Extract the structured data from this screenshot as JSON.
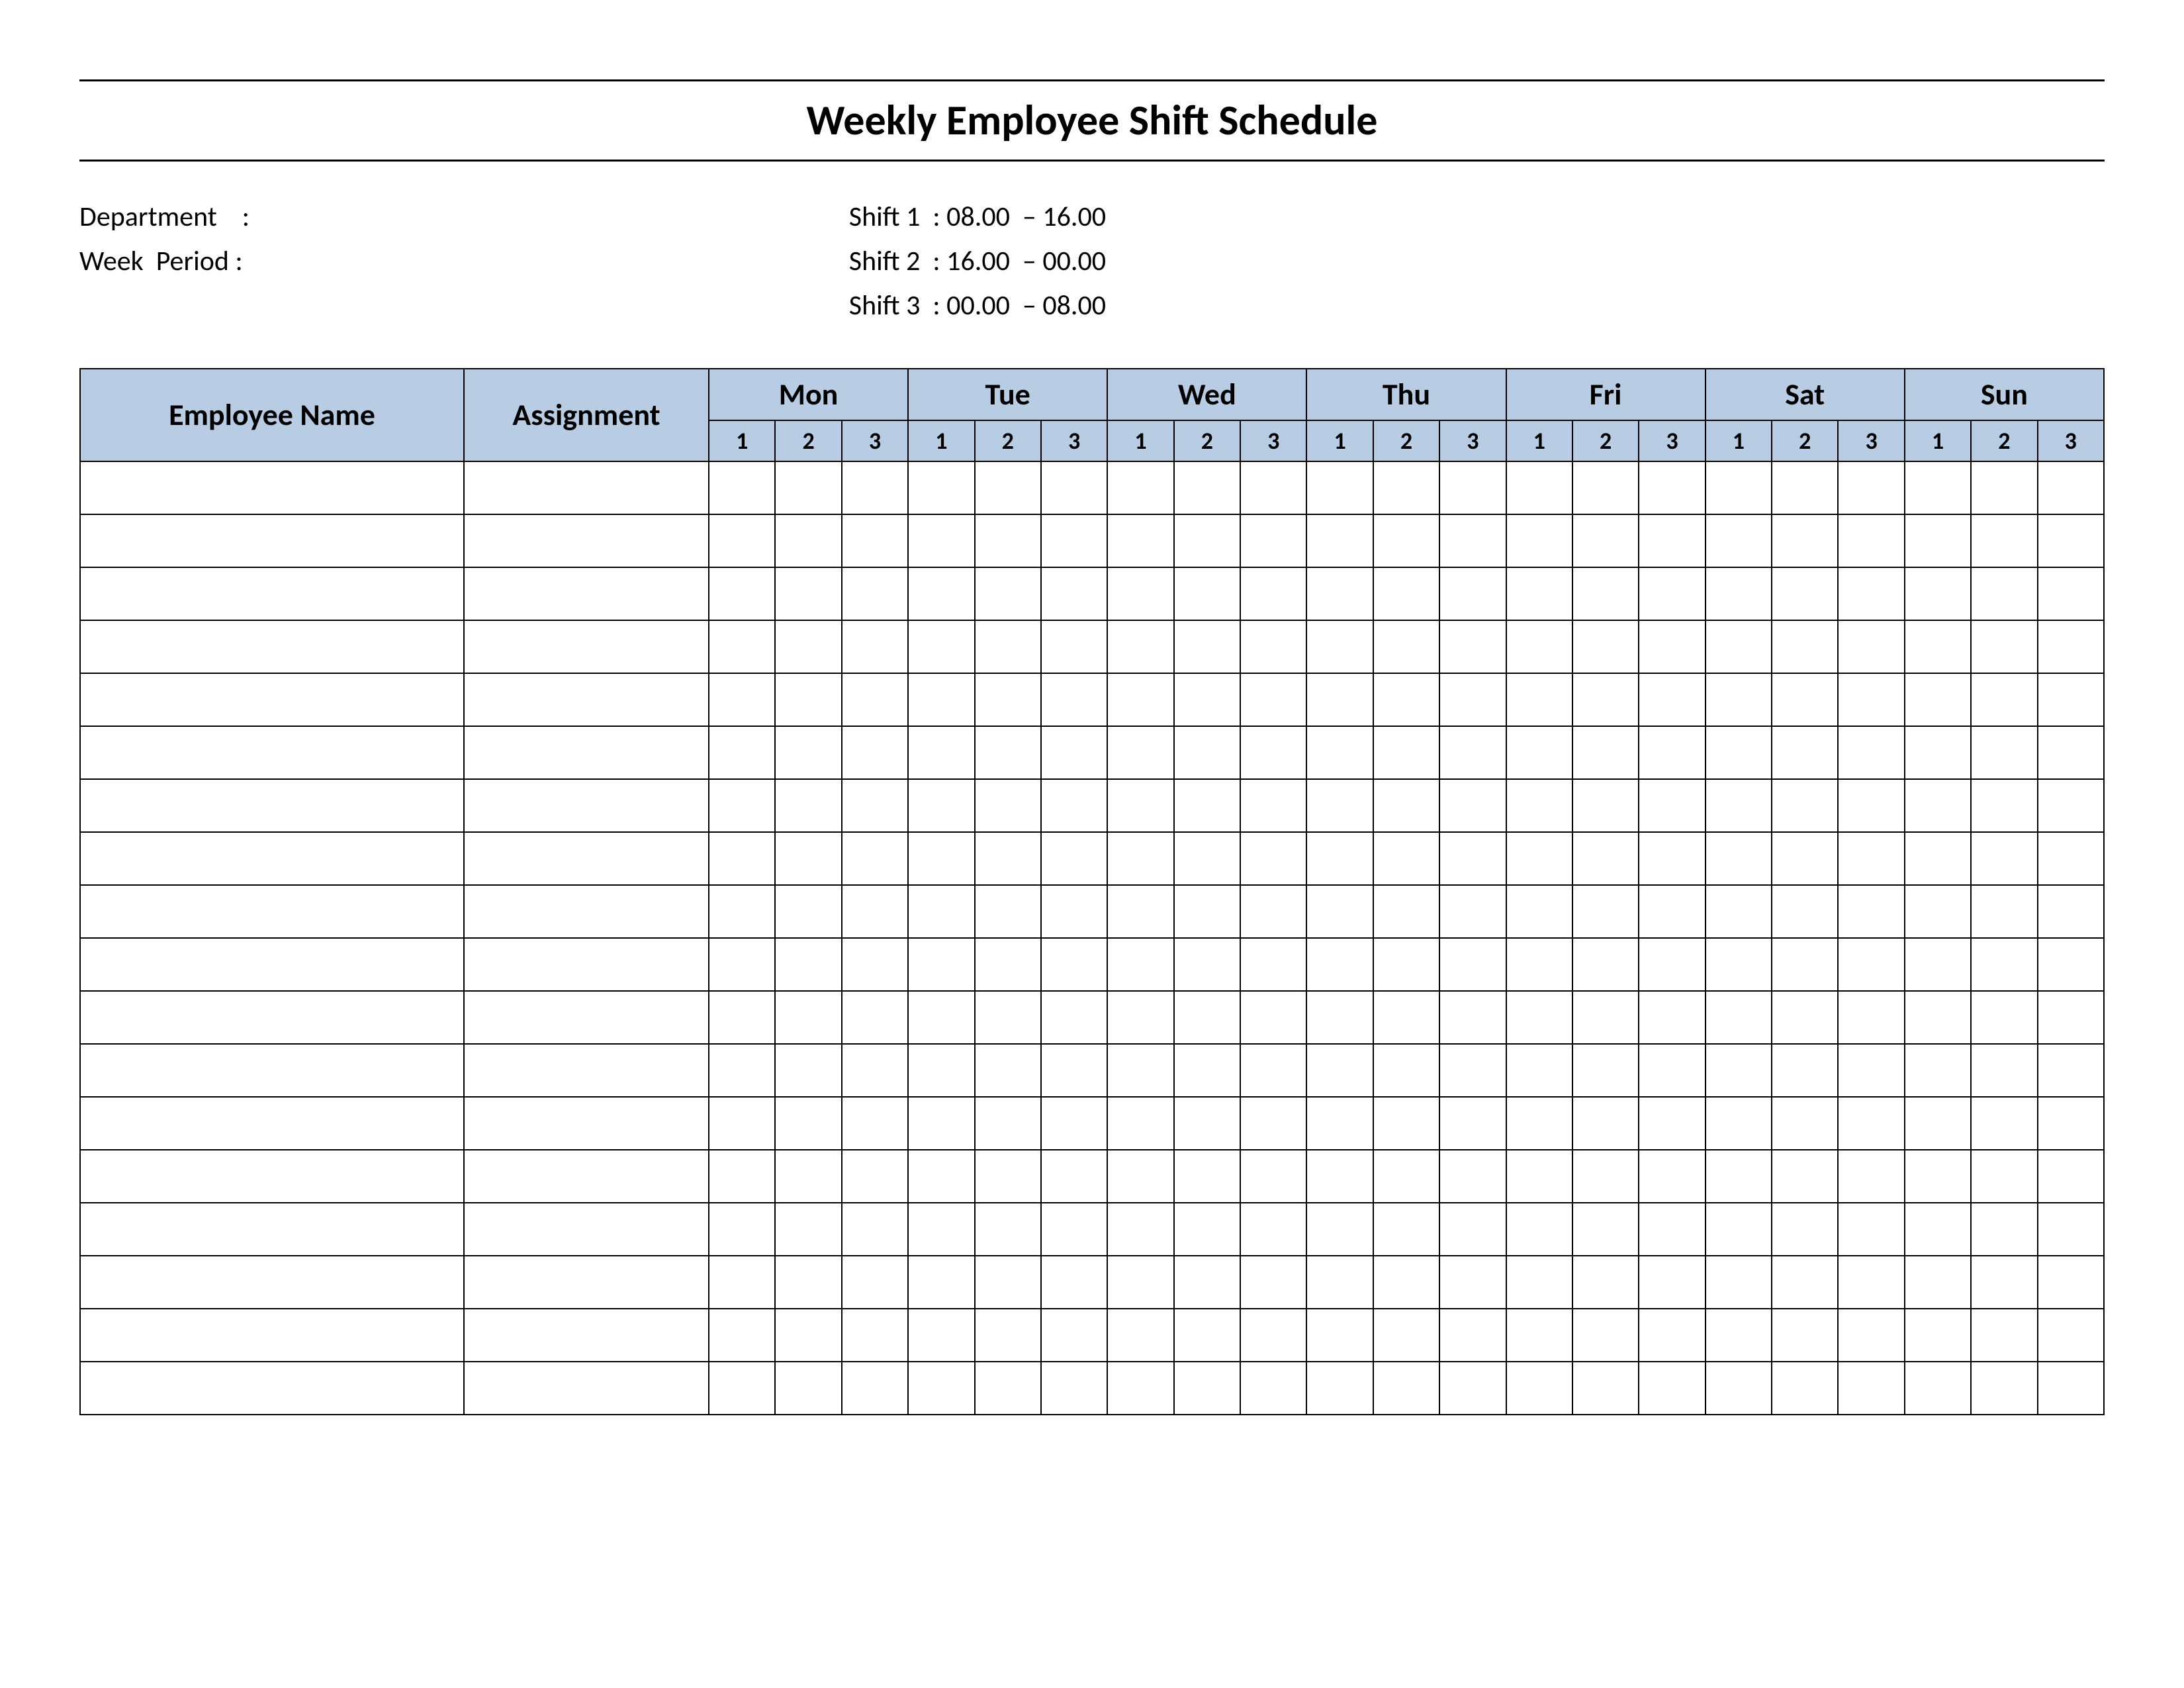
{
  "title": "Weekly Employee Shift Schedule",
  "meta": {
    "department_label": "Department    :",
    "week_period_label": "Week  Period :",
    "shift1": "Shift 1  : 08.00  – 16.00",
    "shift2": "Shift 2  : 16.00  – 00.00",
    "shift3": "Shift 3  : 00.00  – 08.00"
  },
  "headers": {
    "employee_name": "Employee Name",
    "assignment": "Assignment",
    "days": [
      "Mon",
      "Tue",
      "Wed",
      "Thu",
      "Fri",
      "Sat",
      "Sun"
    ],
    "shifts": [
      "1",
      "2",
      "3"
    ]
  },
  "rows": [
    {
      "name": "",
      "assignment": "",
      "cells": [
        "",
        "",
        "",
        "",
        "",
        "",
        "",
        "",
        "",
        "",
        "",
        "",
        "",
        "",
        "",
        "",
        "",
        "",
        "",
        "",
        ""
      ]
    },
    {
      "name": "",
      "assignment": "",
      "cells": [
        "",
        "",
        "",
        "",
        "",
        "",
        "",
        "",
        "",
        "",
        "",
        "",
        "",
        "",
        "",
        "",
        "",
        "",
        "",
        "",
        ""
      ]
    },
    {
      "name": "",
      "assignment": "",
      "cells": [
        "",
        "",
        "",
        "",
        "",
        "",
        "",
        "",
        "",
        "",
        "",
        "",
        "",
        "",
        "",
        "",
        "",
        "",
        "",
        "",
        ""
      ]
    },
    {
      "name": "",
      "assignment": "",
      "cells": [
        "",
        "",
        "",
        "",
        "",
        "",
        "",
        "",
        "",
        "",
        "",
        "",
        "",
        "",
        "",
        "",
        "",
        "",
        "",
        "",
        ""
      ]
    },
    {
      "name": "",
      "assignment": "",
      "cells": [
        "",
        "",
        "",
        "",
        "",
        "",
        "",
        "",
        "",
        "",
        "",
        "",
        "",
        "",
        "",
        "",
        "",
        "",
        "",
        "",
        ""
      ]
    },
    {
      "name": "",
      "assignment": "",
      "cells": [
        "",
        "",
        "",
        "",
        "",
        "",
        "",
        "",
        "",
        "",
        "",
        "",
        "",
        "",
        "",
        "",
        "",
        "",
        "",
        "",
        ""
      ]
    },
    {
      "name": "",
      "assignment": "",
      "cells": [
        "",
        "",
        "",
        "",
        "",
        "",
        "",
        "",
        "",
        "",
        "",
        "",
        "",
        "",
        "",
        "",
        "",
        "",
        "",
        "",
        ""
      ]
    },
    {
      "name": "",
      "assignment": "",
      "cells": [
        "",
        "",
        "",
        "",
        "",
        "",
        "",
        "",
        "",
        "",
        "",
        "",
        "",
        "",
        "",
        "",
        "",
        "",
        "",
        "",
        ""
      ]
    },
    {
      "name": "",
      "assignment": "",
      "cells": [
        "",
        "",
        "",
        "",
        "",
        "",
        "",
        "",
        "",
        "",
        "",
        "",
        "",
        "",
        "",
        "",
        "",
        "",
        "",
        "",
        ""
      ]
    },
    {
      "name": "",
      "assignment": "",
      "cells": [
        "",
        "",
        "",
        "",
        "",
        "",
        "",
        "",
        "",
        "",
        "",
        "",
        "",
        "",
        "",
        "",
        "",
        "",
        "",
        "",
        ""
      ]
    },
    {
      "name": "",
      "assignment": "",
      "cells": [
        "",
        "",
        "",
        "",
        "",
        "",
        "",
        "",
        "",
        "",
        "",
        "",
        "",
        "",
        "",
        "",
        "",
        "",
        "",
        "",
        ""
      ]
    },
    {
      "name": "",
      "assignment": "",
      "cells": [
        "",
        "",
        "",
        "",
        "",
        "",
        "",
        "",
        "",
        "",
        "",
        "",
        "",
        "",
        "",
        "",
        "",
        "",
        "",
        "",
        ""
      ]
    },
    {
      "name": "",
      "assignment": "",
      "cells": [
        "",
        "",
        "",
        "",
        "",
        "",
        "",
        "",
        "",
        "",
        "",
        "",
        "",
        "",
        "",
        "",
        "",
        "",
        "",
        "",
        ""
      ]
    },
    {
      "name": "",
      "assignment": "",
      "cells": [
        "",
        "",
        "",
        "",
        "",
        "",
        "",
        "",
        "",
        "",
        "",
        "",
        "",
        "",
        "",
        "",
        "",
        "",
        "",
        "",
        ""
      ]
    },
    {
      "name": "",
      "assignment": "",
      "cells": [
        "",
        "",
        "",
        "",
        "",
        "",
        "",
        "",
        "",
        "",
        "",
        "",
        "",
        "",
        "",
        "",
        "",
        "",
        "",
        "",
        ""
      ]
    },
    {
      "name": "",
      "assignment": "",
      "cells": [
        "",
        "",
        "",
        "",
        "",
        "",
        "",
        "",
        "",
        "",
        "",
        "",
        "",
        "",
        "",
        "",
        "",
        "",
        "",
        "",
        ""
      ]
    },
    {
      "name": "",
      "assignment": "",
      "cells": [
        "",
        "",
        "",
        "",
        "",
        "",
        "",
        "",
        "",
        "",
        "",
        "",
        "",
        "",
        "",
        "",
        "",
        "",
        "",
        "",
        ""
      ]
    },
    {
      "name": "",
      "assignment": "",
      "cells": [
        "",
        "",
        "",
        "",
        "",
        "",
        "",
        "",
        "",
        "",
        "",
        "",
        "",
        "",
        "",
        "",
        "",
        "",
        "",
        "",
        ""
      ]
    }
  ]
}
